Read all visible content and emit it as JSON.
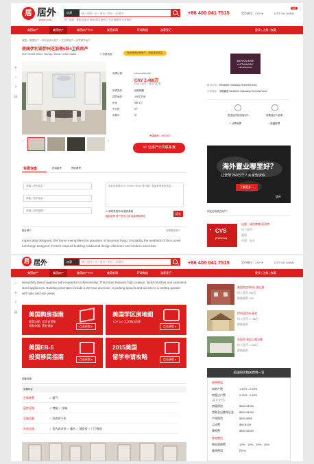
{
  "header": {
    "logo_char": "居",
    "logo_text": "居外",
    "logo_sub": "Juwai.com",
    "search_scope": "房源",
    "search_placeholder": "输入国家 / 州 / 城市 / 地址 / 关键词",
    "hot_searches": "热门搜索：美国 加拿大 澳洲 英国 新西兰 日本 葡萄牙 马来西亚",
    "phone": "+86 400 041 7515",
    "currency": "货币单位：CNY ▾",
    "list_property": "LIST ON JUWAI",
    "list_badge": "免费"
  },
  "nav": {
    "items": [
      "美国房产",
      "美国房产",
      "美国房产中介",
      "美国新闻",
      "环球数据",
      "游客登记"
    ],
    "right": "登录 | 注册 | 收藏"
  },
  "breadcrumb": "美国 > 美国房产 > 伊利诺伊州房产 > 芝加哥房产 > 绿宅豪华房产",
  "listing": {
    "title": "美国伊利诺伊州芝加哥5卧4卫的房产",
    "address": "65 E Goethe Street, Chicago, Illinois, United States",
    "map_link": "查看地图",
    "badge": "在线咨询这栋房产，获取更多信息",
    "price_label": "房源价格",
    "price_usd": "USD 3,888,888",
    "price_cny": "CNY 2,488万",
    "price_note": "约合人民币：按当日汇率",
    "facts": [
      {
        "k": "房源类型",
        "v": "独栋别墅"
      },
      {
        "k": "建筑面积",
        "v": "465平方米"
      },
      {
        "k": "卧室",
        "v": "5卧 4卫"
      },
      {
        "k": "车位数",
        "v": "3个"
      },
      {
        "k": "房屋ID",
        "v": "37"
      }
    ],
    "listing_id_label": "房源编号：",
    "listing_id": "5097557",
    "contact_button": "让房产公司联系我"
  },
  "agent": {
    "company": "BERKSHIRE HATHAWAY",
    "company_sub": "HomeServices",
    "name_label": "经纪公司：",
    "name": "Berkshire Hathaway HomeServices",
    "addr_label": "公司地址：",
    "addr": "中国香港 Berkshire Hathaway HomeServices",
    "actions": [
      "发送站内信给经纪人",
      "查看经纪人信息",
      "分享房源",
      "收藏房源"
    ]
  },
  "inquiry": {
    "tabs": [
      "免费询盘",
      "在线投资",
      "预约看房"
    ],
    "fields": [
      "请输入您的姓名 *",
      "请输入您的电话 *",
      "请输入您的邮箱 *"
    ],
    "message_placeholder": "我对此房源 65 E Goethe Street 感兴趣，希望获得更多信息...",
    "agree": "我同意居外网 服务条款",
    "policy": "隐私政策 房产资讯订阅 免费获取报告",
    "submit": "提交"
  },
  "description": {
    "title": "物业简介",
    "link": "查看更多简介",
    "text_1": "Impeccably designed, this home exemplifies the grandeur of luxurious living. Emulating the aesthetic of the Lucien LaGrange designed, French inspired building, traditional design elements and modern amenities",
    "text_2": "beautifully blend together with masterful craftsmanship. This home features high ceilings, lavish finishes and seamless steel appliances. Building amenities include a 24-hour doorman, 2 parking spaces and access to a rooftop garden with lake and city views."
  },
  "promo": {
    "title": "海外置业哪里好？",
    "subtitle": "让全球 260万华人买家告诉你",
    "button": "了解更多 ››",
    "logo": "居外",
    "caption": "你还在找其它房产？"
  },
  "ad": {
    "brand": "CVS",
    "sub": "pharmacy",
    "title": "出租：绿色商铺 投资房",
    "price": "约人民币：",
    "line2": "面积：",
    "line3": "产权：永久"
  },
  "banners": [
    {
      "title": "美国购房指南",
      "sub": "政策法规 | 买房流程图",
      "sub2": "贷款申请 | 置业指南",
      "btn": "点击获取 ▸"
    },
    {
      "title": "美国学区房地图",
      "sub": "TOP 100 大学周边房源",
      "sub2": "",
      "btn": "点击获取 ▸"
    },
    {
      "title": "美国EB-5",
      "sub": "投资移民指南",
      "sub2": "",
      "btn": "点击获取 ▸"
    },
    {
      "title": "2015美国",
      "sub": "留学申请攻略",
      "sub2": "",
      "btn": "点击获取 ▸"
    }
  ],
  "features": {
    "title": "配套设施",
    "header": "房屋特征",
    "rows": [
      {
        "k": "空调装置",
        "v": "✓ 暖气"
      },
      {
        "k": "厨房设施",
        "v": "✓ 烤箱    ✓ 冰箱"
      },
      {
        "k": "设施设备",
        "v": "✓ 洗衣烘干机"
      },
      {
        "k": "外部设施",
        "v": "✓ 室内游泳池   ✓ 露台   ✓ 健身房   ✓ 门卫服务"
      }
    ]
  },
  "related": {
    "items": [
      {
        "title": "美国芝加哥5卧 独立屋",
        "price": "约人民币 988万",
        "size": "建筑面积 465"
      },
      {
        "title": "伊利诺伊州 豪宅",
        "price": "约人民币 1,788万",
        "size": "建筑面积"
      },
      {
        "title": "芝加哥 高层公寓出售",
        "price": "约人民币 1,988万",
        "size": "建筑面积"
      }
    ]
  },
  "costs": {
    "title": "美国购房相关费用一览",
    "rows": [
      {
        "k": "税费费用",
        "v": ""
      },
      {
        "k": "房地产税",
        "v": "1.20% - 2.50%"
      },
      {
        "k": "房屋过户费",
        "v": "0.20% - 0.40%"
      },
      {
        "k": "(买方支付)",
        "v": ""
      },
      {
        "k": "房屋保险",
        "v": "$300-$1000"
      },
      {
        "k": "贷款及出售保证金",
        "v": "$500-$1000"
      },
      {
        "k": "产权保险",
        "v": "$300-$800"
      },
      {
        "k": "公证费",
        "v": "$50-$150"
      },
      {
        "k": "律师费",
        "v": "$500-$1500"
      },
      {
        "k": "其他费用",
        "v": ""
      },
      {
        "k": "物业管理费",
        "v": "10%、15%、20%、25%"
      },
      {
        "k": "维修费用",
        "v": "约3%"
      }
    ]
  }
}
